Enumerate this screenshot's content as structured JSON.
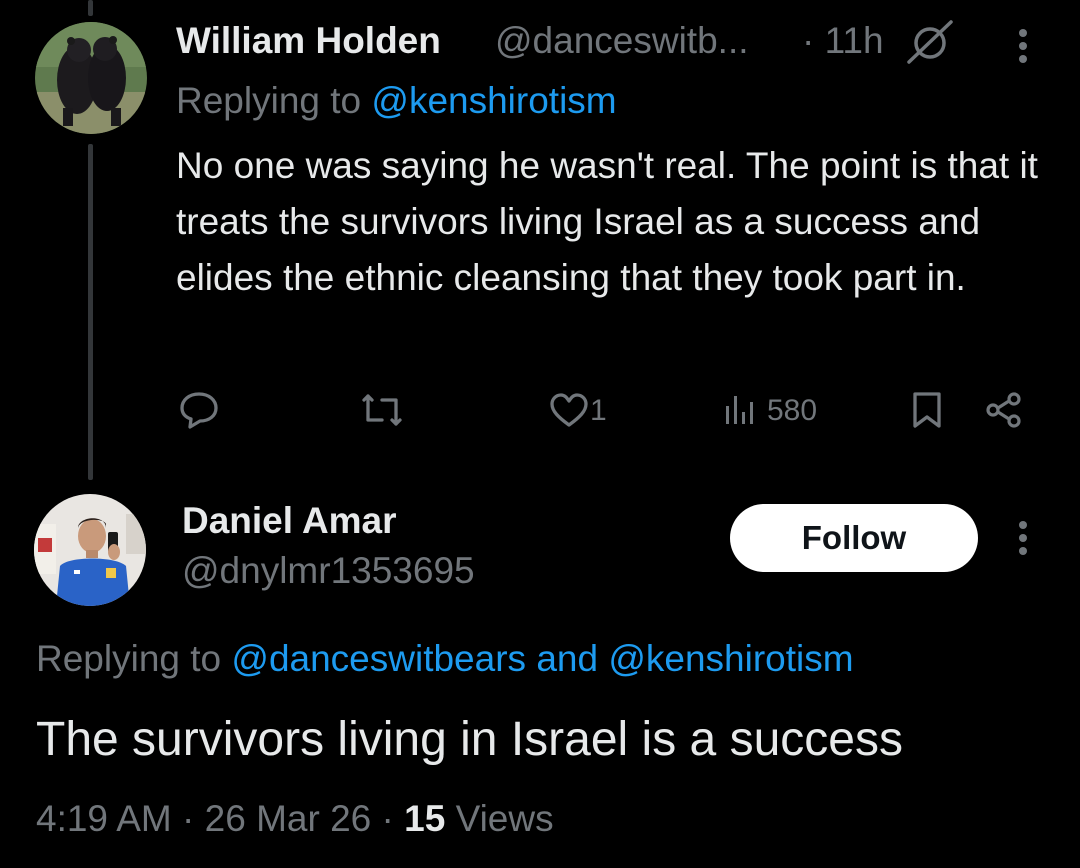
{
  "tweet1": {
    "author_name": "William Holden",
    "author_handle": "@danceswitb...",
    "time": "· 11h",
    "replying_prefix": "Replying to ",
    "replying_to": "@kenshirotism",
    "text": "No one was saying he wasn't real. The point is that it treats the survivors living Israel as a success and elides the ethnic cleansing that they took part in.",
    "likes": "1",
    "views": "580",
    "icons": [
      "grok-icon",
      "more-icon",
      "reply-icon",
      "retweet-icon",
      "like-icon",
      "views-icon",
      "bookmark-icon",
      "share-icon"
    ]
  },
  "tweet2": {
    "author_name": "Daniel Amar",
    "author_handle": "@dnylmr1353695",
    "follow_label": "Follow",
    "replying_prefix": "Replying to ",
    "replying_to_1": "@danceswitbears",
    "replying_and": " and ",
    "replying_to_2": "@kenshirotism",
    "text": "The survivors living in Israel is a success",
    "time": "4:19 AM",
    "date": "26 Mar 26",
    "views_count": "15",
    "views_label": "Views",
    "separator": "·"
  },
  "colors": {
    "background": "#000000",
    "text_primary": "#e7e9ea",
    "text_secondary": "#71767b",
    "link": "#1d9bf0",
    "thread_line": "#333639",
    "follow_bg": "#ffffff"
  }
}
